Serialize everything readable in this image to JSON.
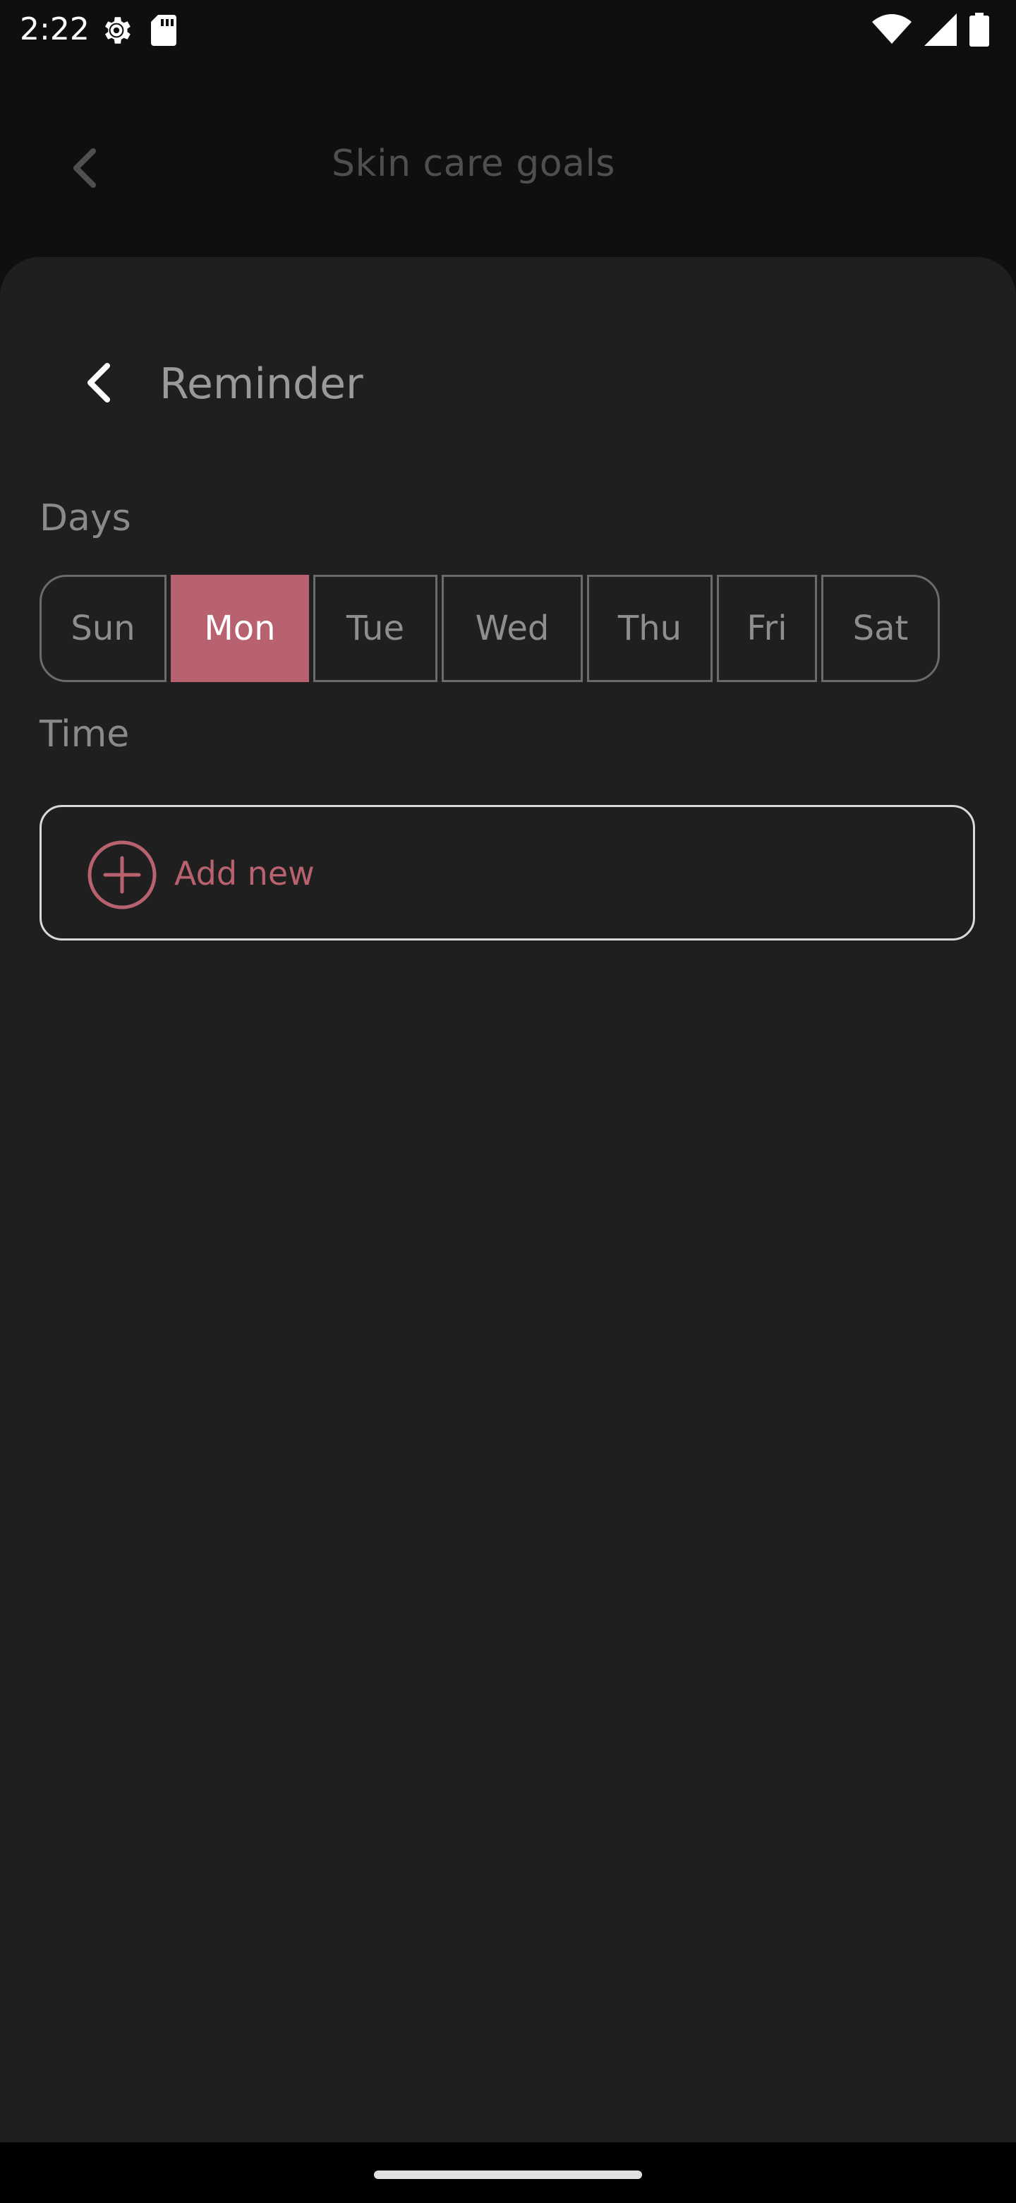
{
  "status_bar": {
    "time": "2:22",
    "icons": [
      "settings-icon",
      "sd-card-icon",
      "wifi-icon",
      "signal-icon",
      "battery-icon"
    ]
  },
  "app_bar": {
    "title": "Skin care goals",
    "back_icon": "chevron-left-icon"
  },
  "sheet": {
    "title": "Reminder",
    "back_icon": "chevron-left-icon",
    "days_label": "Days",
    "days": [
      {
        "label": "Sun",
        "selected": false
      },
      {
        "label": "Mon",
        "selected": true
      },
      {
        "label": "Tue",
        "selected": false
      },
      {
        "label": "Wed",
        "selected": false
      },
      {
        "label": "Thu",
        "selected": false
      },
      {
        "label": "Fri",
        "selected": false
      },
      {
        "label": "Sat",
        "selected": false
      }
    ],
    "time_label": "Time",
    "add_new_label": "Add new",
    "add_icon": "plus-circle-icon"
  },
  "colors": {
    "accent": "#b8616f",
    "sheet_background": "#1f1f1f",
    "page_background": "#0f0f0f"
  }
}
